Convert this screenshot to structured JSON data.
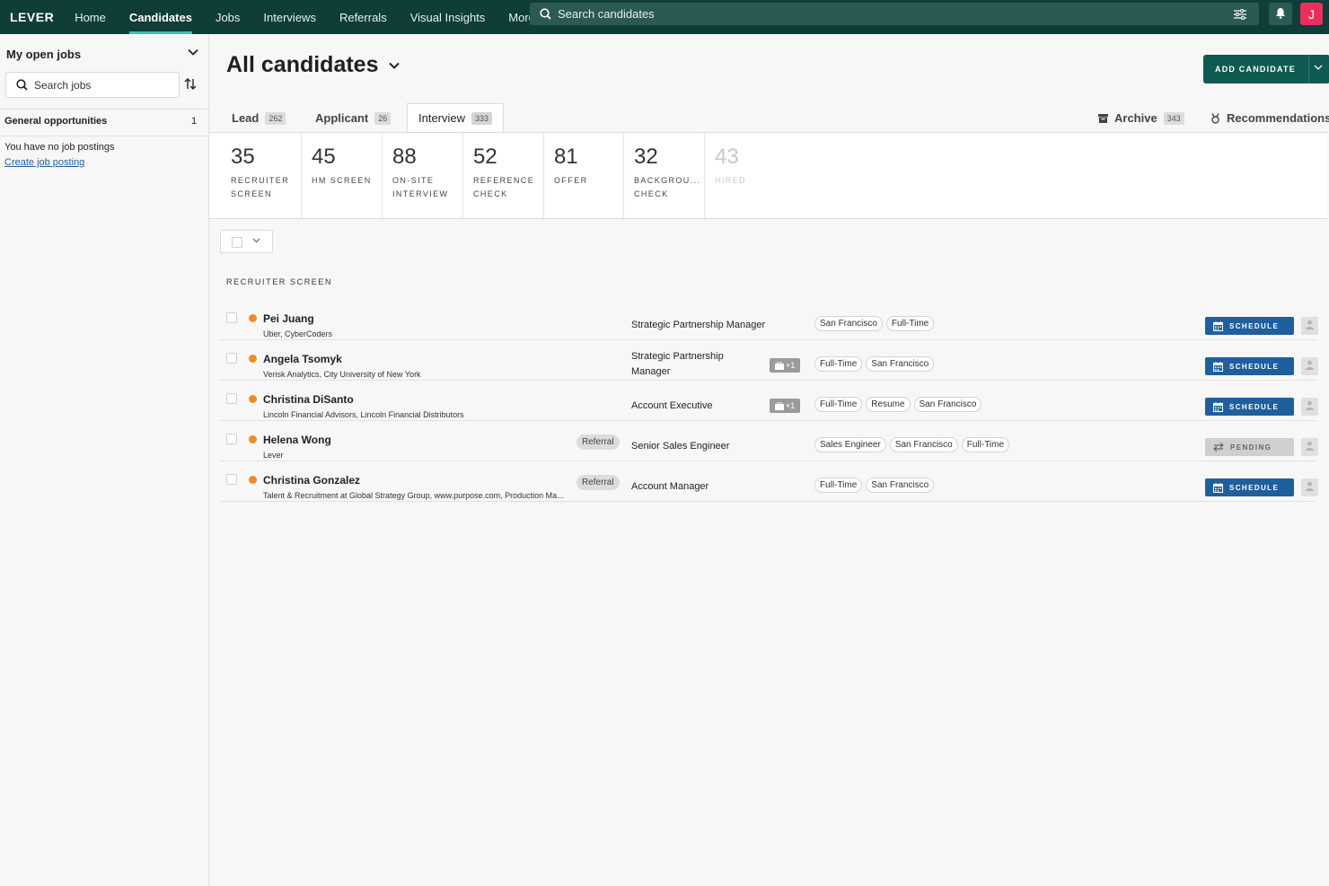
{
  "nav": {
    "logo": "LEVER",
    "items": [
      {
        "label": "Home",
        "active": false
      },
      {
        "label": "Candidates",
        "active": true
      },
      {
        "label": "Jobs",
        "active": false
      },
      {
        "label": "Interviews",
        "active": false
      },
      {
        "label": "Referrals",
        "active": false
      },
      {
        "label": "Visual Insights",
        "active": false
      },
      {
        "label": "More",
        "active": false
      }
    ],
    "search_placeholder": "Search candidates",
    "avatar_initial": "J",
    "colors": {
      "nav_bg": "#0f3d37",
      "active_underline": "#3fc1a5",
      "avatar": "#e8305f"
    }
  },
  "sidebar": {
    "heading": "My open jobs",
    "search_placeholder": "Search jobs",
    "general_label": "General opportunities",
    "general_count": "1",
    "no_postings": "You have no job postings",
    "create_link": "Create job posting"
  },
  "main": {
    "title": "All candidates",
    "add_button": "ADD CANDIDATE",
    "tabs": [
      {
        "label": "Lead",
        "count": "262"
      },
      {
        "label": "Applicant",
        "count": "26"
      },
      {
        "label": "Interview",
        "count": "333"
      }
    ],
    "right_tabs": [
      {
        "label": "Archive",
        "count": "343",
        "icon": "archive-icon"
      },
      {
        "label": "Recommendations",
        "icon": "recommendations-icon"
      }
    ],
    "stages": [
      {
        "num": "35",
        "label": "RECRUITER SCREEN"
      },
      {
        "num": "45",
        "label": "HM SCREEN"
      },
      {
        "num": "88",
        "label": "ON-SITE INTERVIEW"
      },
      {
        "num": "52",
        "label": "REFERENCE CHECK"
      },
      {
        "num": "81",
        "label": "OFFER"
      },
      {
        "num": "32",
        "label": "BACKGROU... CHECK"
      },
      {
        "num": "43",
        "label": "HIRED"
      }
    ],
    "section_title": "RECRUITER SCREEN",
    "candidates": [
      {
        "name": "Pei Juang",
        "org": "Uber, CyberCoders",
        "referral": "",
        "job": "Strategic Partnership Manager",
        "extra": "",
        "tags": [
          "San Francisco",
          "Full-Time"
        ],
        "action": "SCHEDULE"
      },
      {
        "name": "Angela Tsomyk",
        "org": "Verisk Analytics, City University of New York",
        "referral": "",
        "job": "Strategic Partnership Manager",
        "extra": "+1",
        "tags": [
          "Full-Time",
          "San Francisco"
        ],
        "action": "SCHEDULE"
      },
      {
        "name": "Christina DiSanto",
        "org": "Lincoln Financial Advisors, Lincoln Financial Distributors",
        "referral": "",
        "job": "Account Executive",
        "extra": "+1",
        "tags": [
          "Full-Time",
          "Resume",
          "San Francisco"
        ],
        "action": "SCHEDULE"
      },
      {
        "name": "Helena Wong",
        "org": "Lever",
        "referral": "Referral",
        "job": "Senior Sales Engineer",
        "extra": "",
        "tags": [
          "Sales Engineer",
          "San Francisco",
          "Full-Time"
        ],
        "action": "PENDING"
      },
      {
        "name": "Christina Gonzalez",
        "org": "Talent & Recruitment at Global Strategy Group, www.purpose.com, Production Ma...",
        "referral": "Referral",
        "job": "Account Manager",
        "extra": "",
        "tags": [
          "Full-Time",
          "San Francisco"
        ],
        "action": "SCHEDULE"
      }
    ],
    "colors": {
      "schedule": "#1f5f9e",
      "status_dot": "#f08a24",
      "add_button": "#0f5a51"
    }
  }
}
